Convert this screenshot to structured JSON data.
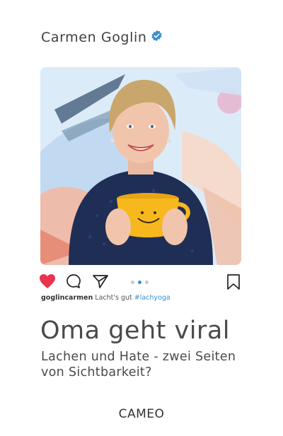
{
  "author": {
    "name": "Carmen Goglin",
    "verified_icon": "verified-badge-icon",
    "badge_color": "#3b8fd0"
  },
  "post": {
    "username": "goglincarmen",
    "caption_text": "Lacht's gut",
    "hashtag": "#lachyoga",
    "carousel_total": 3,
    "carousel_active_index": 2,
    "icons": [
      "heart-icon",
      "comment-icon",
      "share-icon",
      "bookmark-icon"
    ],
    "heart_color": "#e8344e"
  },
  "book": {
    "title": "Oma geht viral",
    "subtitle_line1": "Lachen und Hate - zwei Seiten",
    "subtitle_line2": "von Sichtbarkeit?",
    "publisher": "CAMEO"
  }
}
